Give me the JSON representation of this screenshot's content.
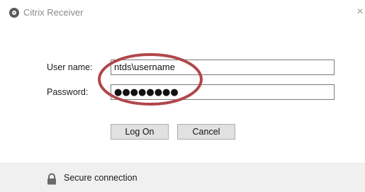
{
  "window": {
    "title": "Citrix Receiver",
    "close_glyph": "×"
  },
  "form": {
    "username_label": "User name:",
    "username_value": "ntds\\username",
    "password_label": "Password:",
    "password_masked": "●●●●●●●●"
  },
  "buttons": {
    "logon_label": "Log On",
    "cancel_label": "Cancel"
  },
  "footer": {
    "secure_text": "Secure connection",
    "icon": "lock-icon"
  },
  "annotation": {
    "shape": "ellipse",
    "color": "#b0474a"
  },
  "colors": {
    "footer_bg": "#f0f0f0",
    "button_bg": "#e1e1e1",
    "field_border": "#7a7a7a"
  }
}
